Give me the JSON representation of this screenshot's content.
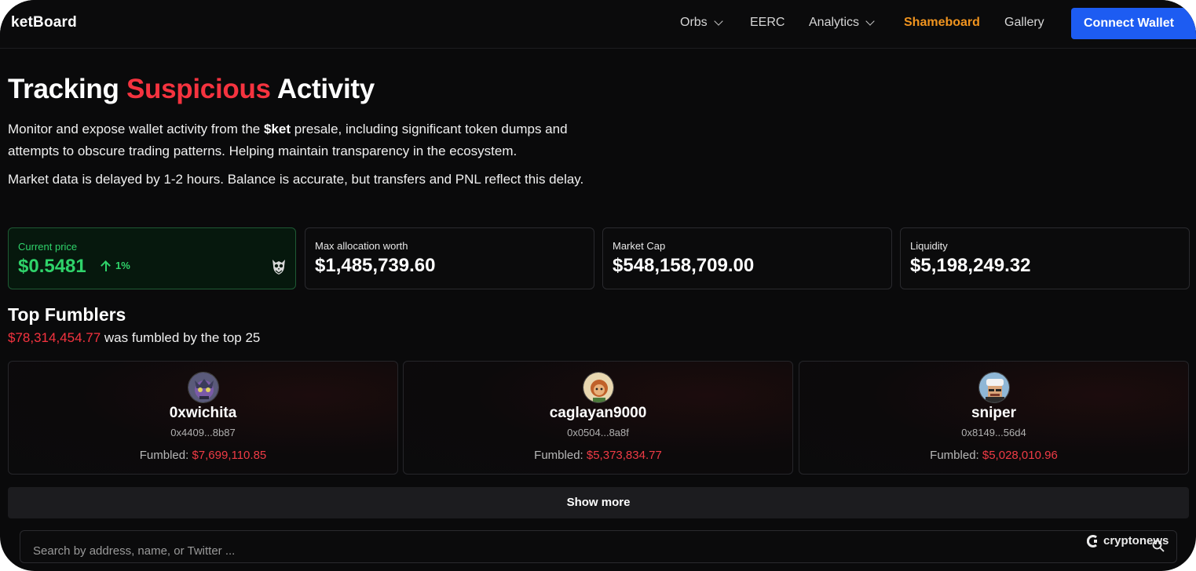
{
  "nav": {
    "brand": "ketBoard",
    "items": [
      {
        "label": "Orbs",
        "dropdown": true
      },
      {
        "label": "EERC",
        "dropdown": false
      },
      {
        "label": "Analytics",
        "dropdown": true
      },
      {
        "label": "Shameboard",
        "dropdown": false,
        "active": true
      },
      {
        "label": "Gallery",
        "dropdown": false
      }
    ],
    "connect": "Connect Wallet"
  },
  "hero": {
    "title_a": "Tracking",
    "title_b": "Suspicious",
    "title_c": "Activity",
    "p1_a": "Monitor and expose wallet activity from the",
    "p1_b": "$ket",
    "p1_c": "presale, including significant token dumps and attempts to obscure trading patterns. Helping maintain transparency in the ecosystem.",
    "p2": "Market data is delayed by 1-2 hours. Balance is accurate, but transfers and PNL reflect this delay."
  },
  "stats": {
    "price": {
      "label": "Current price",
      "value": "$0.5481",
      "change": "1%",
      "icon": "owl-icon"
    },
    "max_alloc": {
      "label": "Max allocation worth",
      "value": "$1,485,739.60"
    },
    "market_cap": {
      "label": "Market Cap",
      "value": "$548,158,709.00"
    },
    "liquidity": {
      "label": "Liquidity",
      "value": "$5,198,249.32"
    }
  },
  "fumblers": {
    "title": "Top Fumblers",
    "total": "$78,314,454.77",
    "total_suffix": "was fumbled by the top 25",
    "fumbled_label": "Fumbled:",
    "cards": [
      {
        "name": "0xwichita",
        "address": "0x4409...8b87",
        "amount": "$7,699,110.85"
      },
      {
        "name": "caglayan9000",
        "address": "0x0504...8a8f",
        "amount": "$5,373,834.77"
      },
      {
        "name": "sniper",
        "address": "0x8149...56d4",
        "amount": "$5,028,010.96"
      }
    ],
    "show_more": "Show more"
  },
  "search": {
    "placeholder": "Search by address, name, or Twitter ..."
  },
  "watermark": "cryptonews",
  "colors": {
    "accent_red": "#f5333f",
    "accent_green": "#2fd36a",
    "accent_orange": "#f0941f",
    "connect_blue": "#1d5cf2",
    "bg": "#0a0a0b"
  }
}
